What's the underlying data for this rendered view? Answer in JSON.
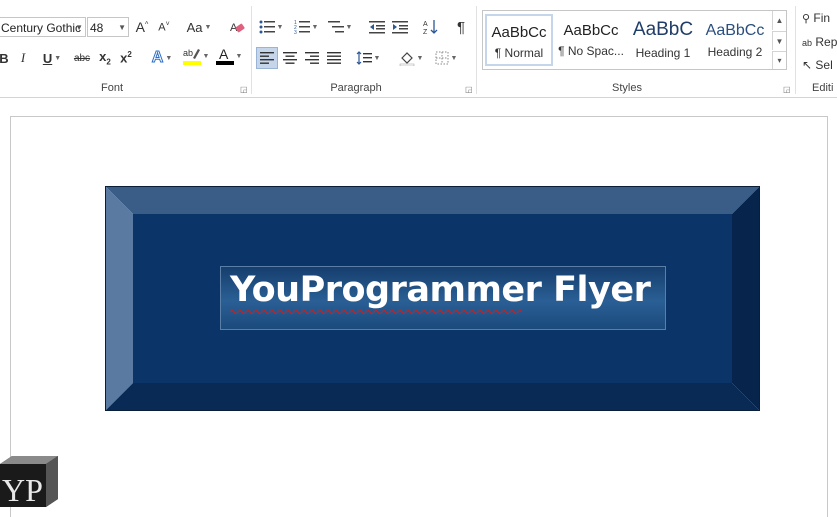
{
  "font": {
    "name": "Century Gothic",
    "size": "48",
    "group_label": "Font"
  },
  "paragraph": {
    "group_label": "Paragraph"
  },
  "styles": {
    "group_label": "Styles",
    "items": [
      {
        "sample": "AaBbCc",
        "name": "¶ Normal"
      },
      {
        "sample": "AaBbCc",
        "name": "¶ No Spac..."
      },
      {
        "sample": "AaBbC",
        "name": "Heading 1"
      },
      {
        "sample": "AaBbCc",
        "name": "Heading 2"
      }
    ]
  },
  "editing": {
    "group_label": "Editi",
    "find": "Fin",
    "replace": "Rep",
    "select": "Sel"
  },
  "document": {
    "title": "YouProgrammer Flyer"
  },
  "logo": {
    "text": "YP"
  },
  "colors": {
    "bevel_face": "#0b3468",
    "bevel_top": "#3a5d88",
    "bevel_left": "#5a7aa2",
    "bevel_right": "#07244d",
    "bevel_bottom": "#082a55",
    "highlight_yellow": "#ffff00",
    "font_color_red": "#000000"
  }
}
